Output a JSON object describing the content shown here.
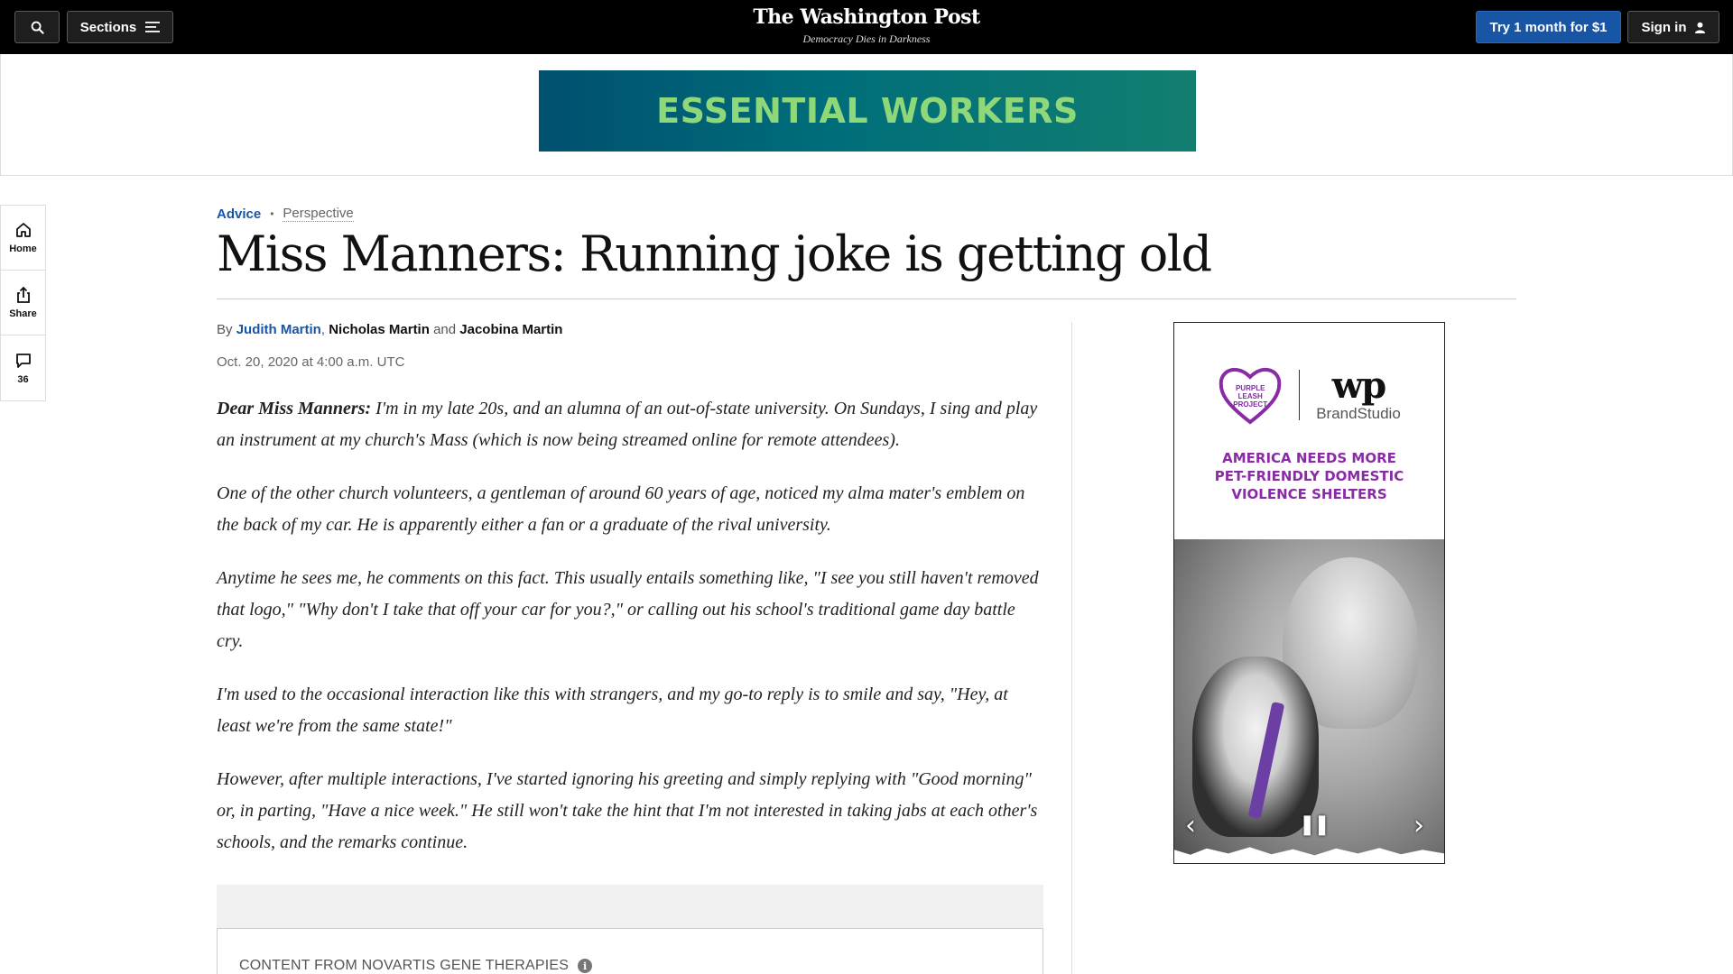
{
  "header": {
    "sections_label": "Sections",
    "logo": "The Washington Post",
    "tagline": "Democracy Dies in Darkness",
    "subscribe_label": "Try 1 month for $1",
    "signin_label": "Sign in"
  },
  "top_ad": {
    "text": "ESSENTIAL WORKERS",
    "colors": {
      "background": "#00506f",
      "text": "#8fd87a"
    }
  },
  "rail": {
    "home_label": "Home",
    "share_label": "Share",
    "comments_count": "36"
  },
  "article": {
    "kicker_section": "Advice",
    "kicker_type": "Perspective",
    "headline": "Miss Manners: Running joke is getting old",
    "byline_prefix": "By",
    "author1": "Judith Martin",
    "sep1": ",",
    "author2": "Nicholas Martin",
    "sep2": "and",
    "author3": "Jacobina Martin",
    "date": "Oct. 20, 2020 at 4:00 a.m. UTC",
    "lead_in": "Dear Miss Manners:",
    "paragraphs": [
      "I'm in my late 20s, and an alumna of an out-of-state university. On Sundays, I sing and play an instrument at my church's Mass (which is now being streamed online for remote attendees).",
      "One of the other church volunteers, a gentleman of around 60 years of age, noticed my alma mater's emblem on the back of my car. He is apparently either a fan or a graduate of the rival university.",
      "Anytime he sees me, he comments on this fact. This usually entails something like, \"I see you still haven't removed that logo,\" \"Why don't I take that off your car for you?,\" or calling out his school's traditional game day battle cry.",
      "I'm used to the occasional interaction like this with strangers, and my go-to reply is to smile and say, \"Hey, at least we're from the same state!\"",
      "However, after multiple interactions, I've started ignoring his greeting and simply replying with \"Good morning\" or, in parting, \"Have a nice week.\" He still won't take the hint that I'm not interested in taking jabs at each other's schools, and the remarks continue."
    ],
    "sponsored_label": "CONTENT FROM NOVARTIS GENE THERAPIES"
  },
  "side_ad": {
    "partner_logo_text": "PURPLE LEASH PROJECT",
    "wp_mark": "wp",
    "brand_studio": "BrandStudio",
    "headline_lines": [
      "AMERICA NEEDS MORE",
      "PET-FRIENDLY DOMESTIC",
      "VIOLENCE SHELTERS"
    ],
    "colors": {
      "headline": "#8a2ba6"
    }
  },
  "colors": {
    "accent": "#1955a5",
    "topbar": "#000000"
  }
}
